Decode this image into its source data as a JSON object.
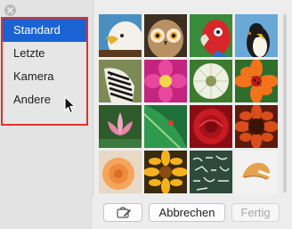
{
  "sidebar": {
    "categories": [
      {
        "label": "Standard",
        "selected": true
      },
      {
        "label": "Letzte",
        "selected": false
      },
      {
        "label": "Kamera",
        "selected": false
      },
      {
        "label": "Andere",
        "selected": false
      }
    ]
  },
  "grid": {
    "images": [
      "eagle",
      "owl",
      "parrot",
      "penguin",
      "zebra",
      "pink-flower",
      "dandelion",
      "ladybug-flower",
      "lotus",
      "green-leaf",
      "red-rose",
      "sunflower-red",
      "orange-rose",
      "yellow-flower",
      "chalkboard",
      "fortune-cookie"
    ]
  },
  "buttons": {
    "camera_icon": "camera-edit-icon",
    "cancel_label": "Abbrechen",
    "done_label": "Fertig"
  },
  "colors": {
    "selection": "#1a63d5",
    "highlight_border": "#e0312b"
  }
}
